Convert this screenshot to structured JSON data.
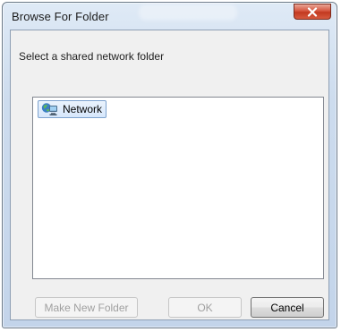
{
  "window": {
    "title": "Browse For Folder",
    "close_icon": "close-icon"
  },
  "dialog": {
    "instruction": "Select a shared network folder"
  },
  "tree": {
    "items": [
      {
        "label": "Network",
        "icon": "network-icon",
        "selected": true
      }
    ]
  },
  "buttons": {
    "make_new_folder": "Make New Folder",
    "ok": "OK",
    "cancel": "Cancel"
  },
  "colors": {
    "close_button": "#c2391f",
    "selection_border": "#7da2ce",
    "disabled_text": "#a0a0a0"
  }
}
